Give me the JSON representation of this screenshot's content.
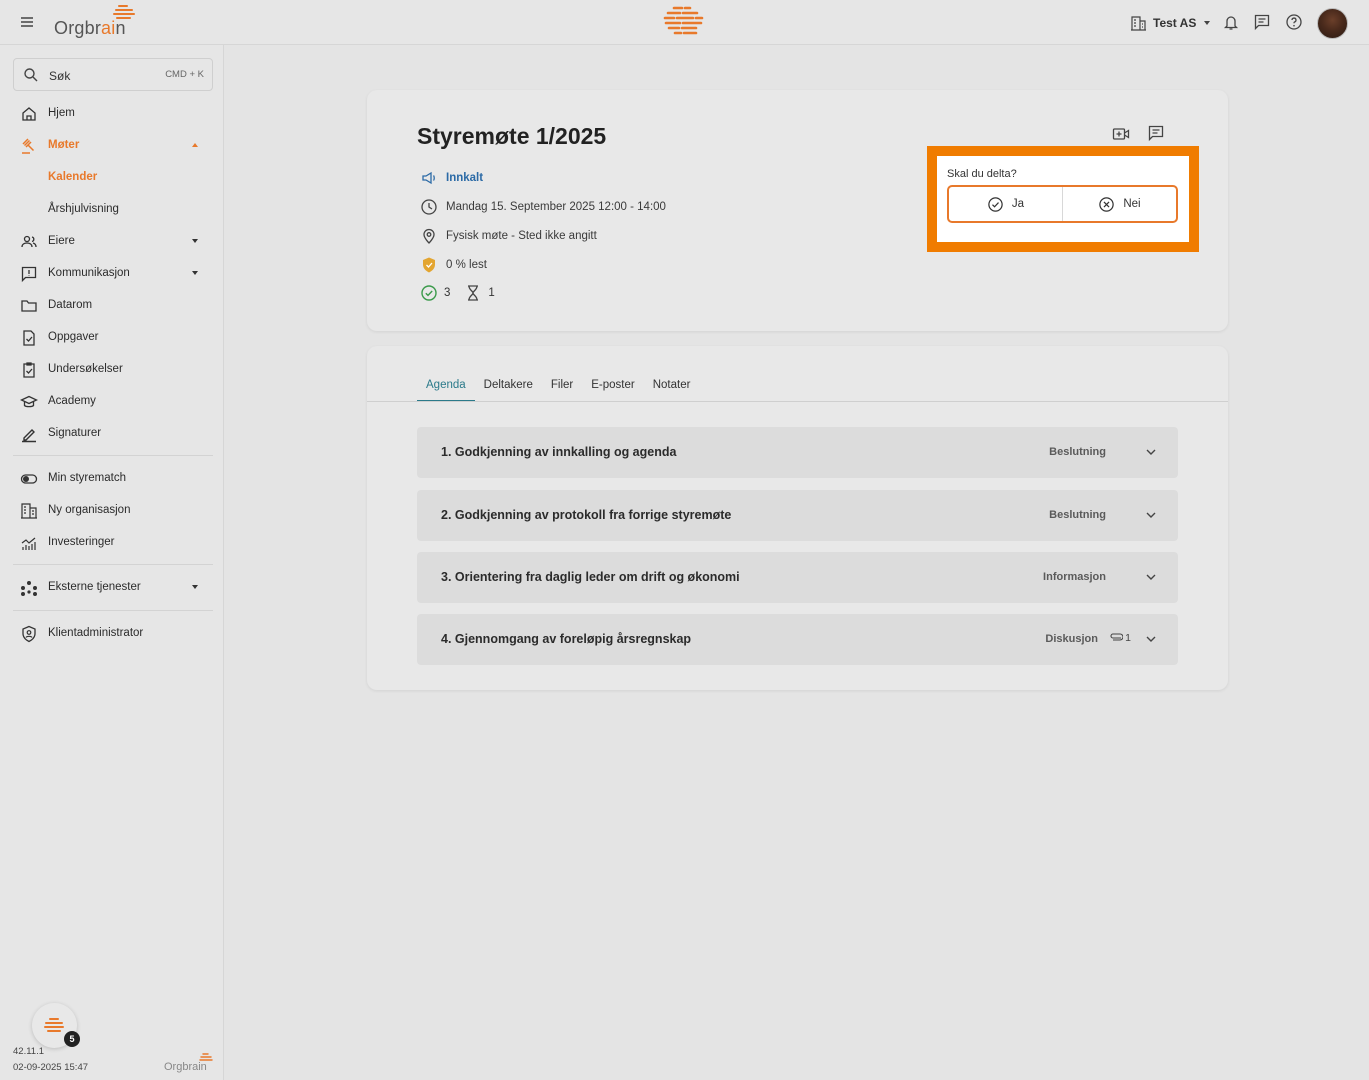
{
  "app": {
    "logo_text_main": "Orgbr",
    "logo_text_accent": "ai",
    "logo_text_end": "n",
    "brand_color": "#e8792b"
  },
  "topbar": {
    "org_name": "Test AS",
    "icons": [
      "menu-icon",
      "building-icon",
      "bell-icon",
      "chat-icon",
      "help-icon"
    ]
  },
  "sidebar": {
    "search_label": "Søk",
    "search_shortcut": "CMD + K",
    "items": [
      {
        "label": "Hjem",
        "icon": "home-icon"
      },
      {
        "label": "Møter",
        "icon": "gavel-icon",
        "expanded": true
      },
      {
        "label": "Kalender"
      },
      {
        "label": "Årshjulvisning"
      },
      {
        "label": "Eiere",
        "icon": "people-icon"
      },
      {
        "label": "Kommunikasjon",
        "icon": "message-icon"
      },
      {
        "label": "Datarom",
        "icon": "folder-icon"
      },
      {
        "label": "Oppgaver",
        "icon": "task-icon"
      },
      {
        "label": "Undersøkelser",
        "icon": "survey-icon"
      },
      {
        "label": "Academy",
        "icon": "academy-icon"
      },
      {
        "label": "Signaturer",
        "icon": "pen-icon"
      },
      {
        "label": "Min styrematch",
        "icon": "toggle-icon"
      },
      {
        "label": "Ny organisasjon",
        "icon": "building-icon"
      },
      {
        "label": "Investeringer",
        "icon": "chart-icon"
      },
      {
        "label": "Eksterne tjenester",
        "icon": "services-icon"
      },
      {
        "label": "Klientadministrator",
        "icon": "shield-icon"
      }
    ],
    "notification_count": "5",
    "version": "42.11.1",
    "build_date": "02-09-2025 15:47",
    "footer_logo": "Orgbrain"
  },
  "meeting": {
    "title": "Styremøte 1/2025",
    "status": "Innkalt",
    "datetime": "Mandag 15. September 2025 12:00 - 14:00",
    "location": "Fysisk møte - Sted ikke angitt",
    "read_status": "0 % lest",
    "accepted_count": "3",
    "pending_count": "1"
  },
  "rsvp": {
    "question": "Skal du delta?",
    "yes_label": "Ja",
    "no_label": "Nei",
    "highlight_color": "#f07c00"
  },
  "tabs": [
    "Agenda",
    "Deltakere",
    "Filer",
    "E-poster",
    "Notater"
  ],
  "agenda": [
    {
      "title": "1. Godkjenning av innkalling og agenda",
      "type": "Beslutning"
    },
    {
      "title": "2. Godkjenning av protokoll fra forrige styremøte",
      "type": "Beslutning"
    },
    {
      "title": "3. Orientering fra daglig leder om drift og økonomi",
      "type": "Informasjon"
    },
    {
      "title": "4. Gjennomgang av foreløpig årsregnskap",
      "type": "Diskusjon",
      "attachments": "1"
    }
  ]
}
